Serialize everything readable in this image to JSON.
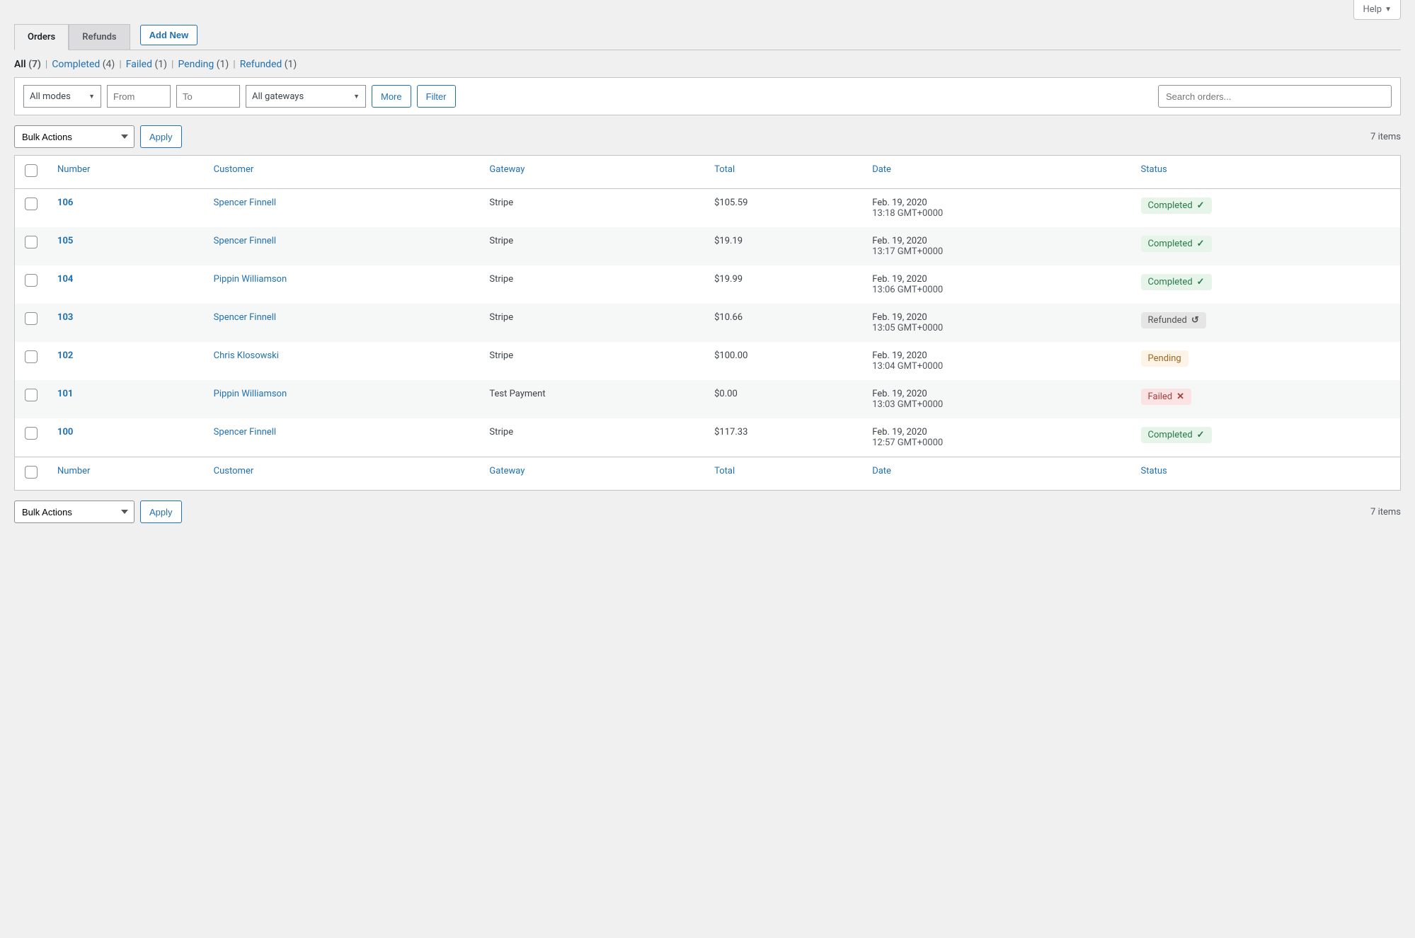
{
  "help": {
    "label": "Help"
  },
  "tabs": {
    "orders": "Orders",
    "refunds": "Refunds",
    "add_new": "Add New"
  },
  "subsubsub": {
    "all_label": "All",
    "all_count": "(7)",
    "completed_label": "Completed",
    "completed_count": "(4)",
    "failed_label": "Failed",
    "failed_count": "(1)",
    "pending_label": "Pending",
    "pending_count": "(1)",
    "refunded_label": "Refunded",
    "refunded_count": "(1)"
  },
  "filters": {
    "modes": "All modes",
    "from_ph": "From",
    "to_ph": "To",
    "gateways": "All gateways",
    "more": "More",
    "filter": "Filter",
    "search_ph": "Search orders..."
  },
  "bulk": {
    "label": "Bulk Actions",
    "apply": "Apply"
  },
  "items_count": "7 items",
  "columns": {
    "number": "Number",
    "customer": "Customer",
    "gateway": "Gateway",
    "total": "Total",
    "date": "Date",
    "status": "Status"
  },
  "rows": [
    {
      "number": "106",
      "customer": "Spencer Finnell",
      "gateway": "Stripe",
      "total": "$105.59",
      "date1": "Feb. 19, 2020",
      "date2": "13:18 GMT+0000",
      "status_label": "Completed",
      "status_kind": "completed"
    },
    {
      "number": "105",
      "customer": "Spencer Finnell",
      "gateway": "Stripe",
      "total": "$19.19",
      "date1": "Feb. 19, 2020",
      "date2": "13:17 GMT+0000",
      "status_label": "Completed",
      "status_kind": "completed"
    },
    {
      "number": "104",
      "customer": "Pippin Williamson",
      "gateway": "Stripe",
      "total": "$19.99",
      "date1": "Feb. 19, 2020",
      "date2": "13:06 GMT+0000",
      "status_label": "Completed",
      "status_kind": "completed"
    },
    {
      "number": "103",
      "customer": "Spencer Finnell",
      "gateway": "Stripe",
      "total": "$10.66",
      "date1": "Feb. 19, 2020",
      "date2": "13:05 GMT+0000",
      "status_label": "Refunded",
      "status_kind": "refunded"
    },
    {
      "number": "102",
      "customer": "Chris Klosowski",
      "gateway": "Stripe",
      "total": "$100.00",
      "date1": "Feb. 19, 2020",
      "date2": "13:04 GMT+0000",
      "status_label": "Pending",
      "status_kind": "pending"
    },
    {
      "number": "101",
      "customer": "Pippin Williamson",
      "gateway": "Test Payment",
      "total": "$0.00",
      "date1": "Feb. 19, 2020",
      "date2": "13:03 GMT+0000",
      "status_label": "Failed",
      "status_kind": "failed"
    },
    {
      "number": "100",
      "customer": "Spencer Finnell",
      "gateway": "Stripe",
      "total": "$117.33",
      "date1": "Feb. 19, 2020",
      "date2": "12:57 GMT+0000",
      "status_label": "Completed",
      "status_kind": "completed"
    }
  ]
}
